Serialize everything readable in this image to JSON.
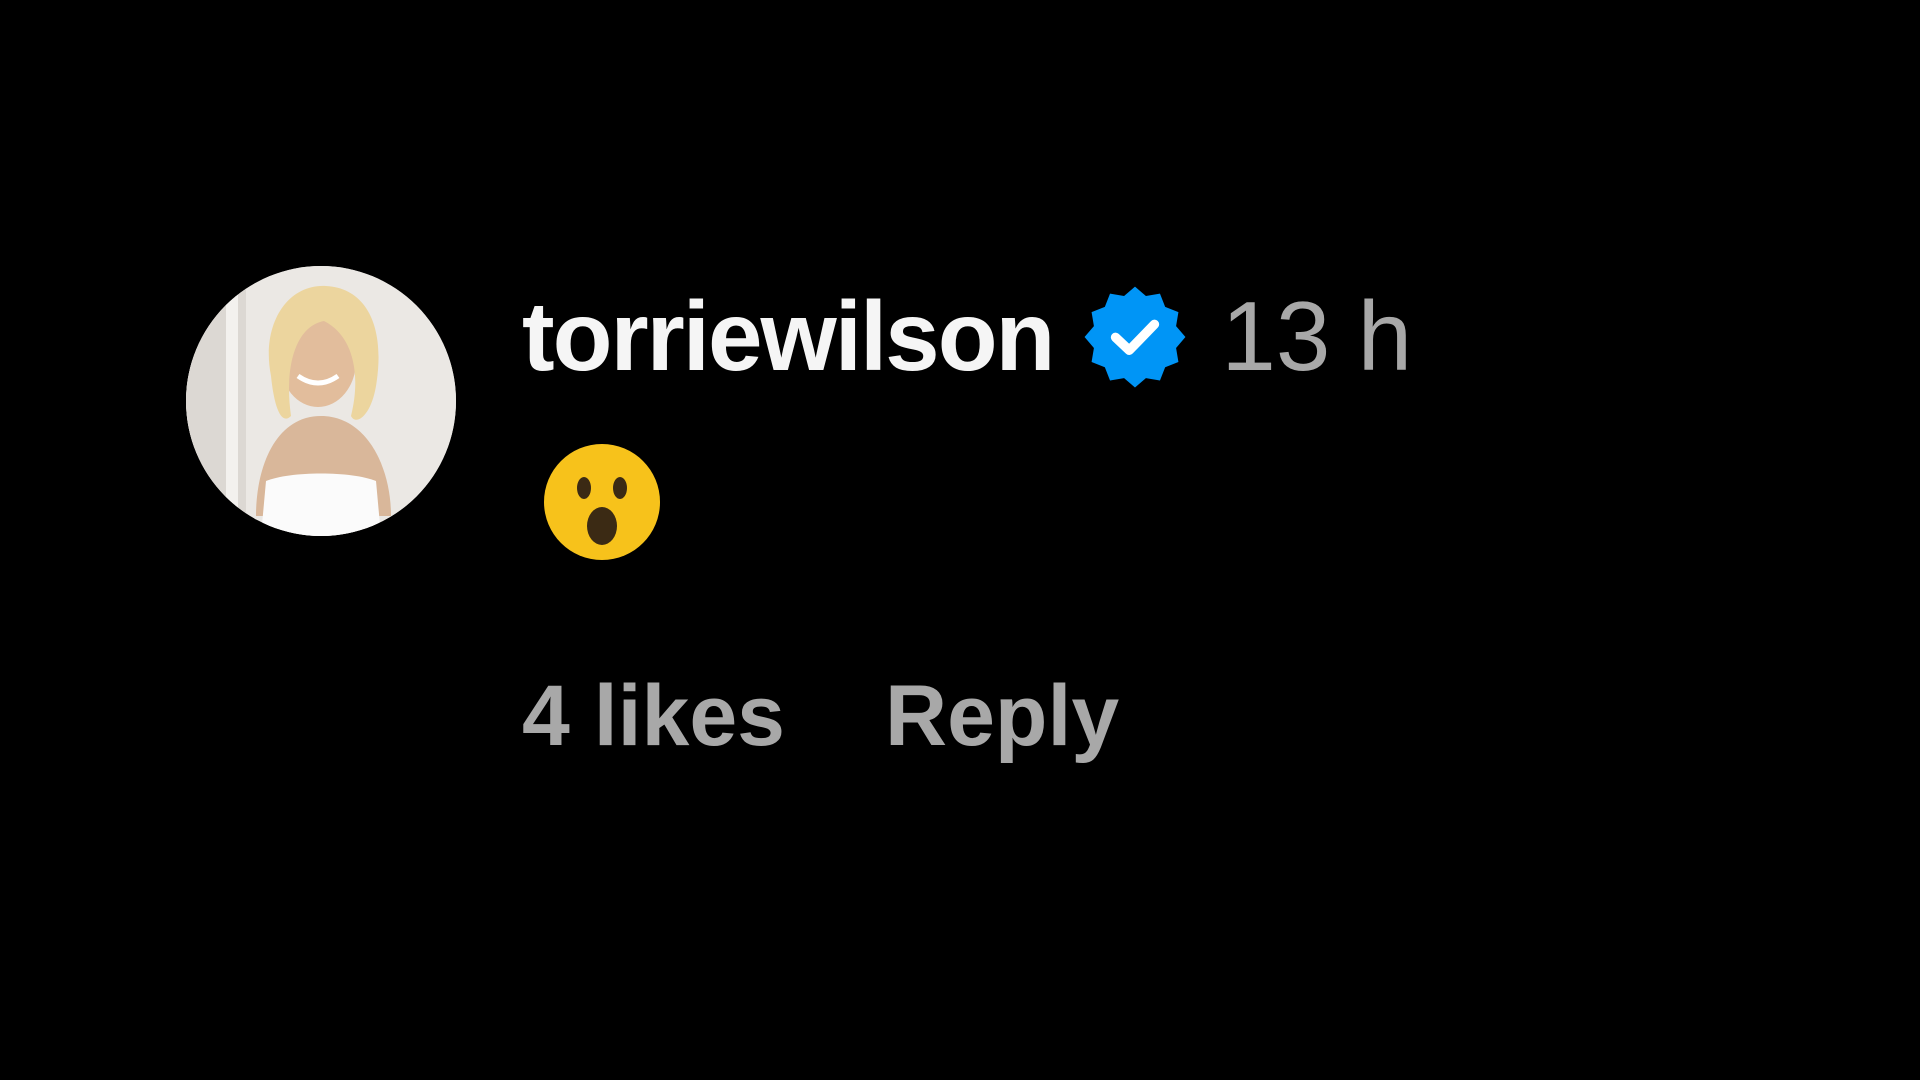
{
  "comment": {
    "avatar_icon": "profile-photo",
    "username": "torriewilson",
    "verified_icon": "verified-badge-icon",
    "verified_color": "#0095F6",
    "timestamp": "13 h",
    "body_emoji": "😮",
    "body_emoji_icon": "face-with-open-mouth-emoji",
    "likes_label": "4 likes",
    "reply_label": "Reply"
  },
  "colors": {
    "background": "#000000",
    "username": "#F5F5F5",
    "secondary_text": "#A8A8A8",
    "emoji_yellow": "#F7C21B"
  }
}
